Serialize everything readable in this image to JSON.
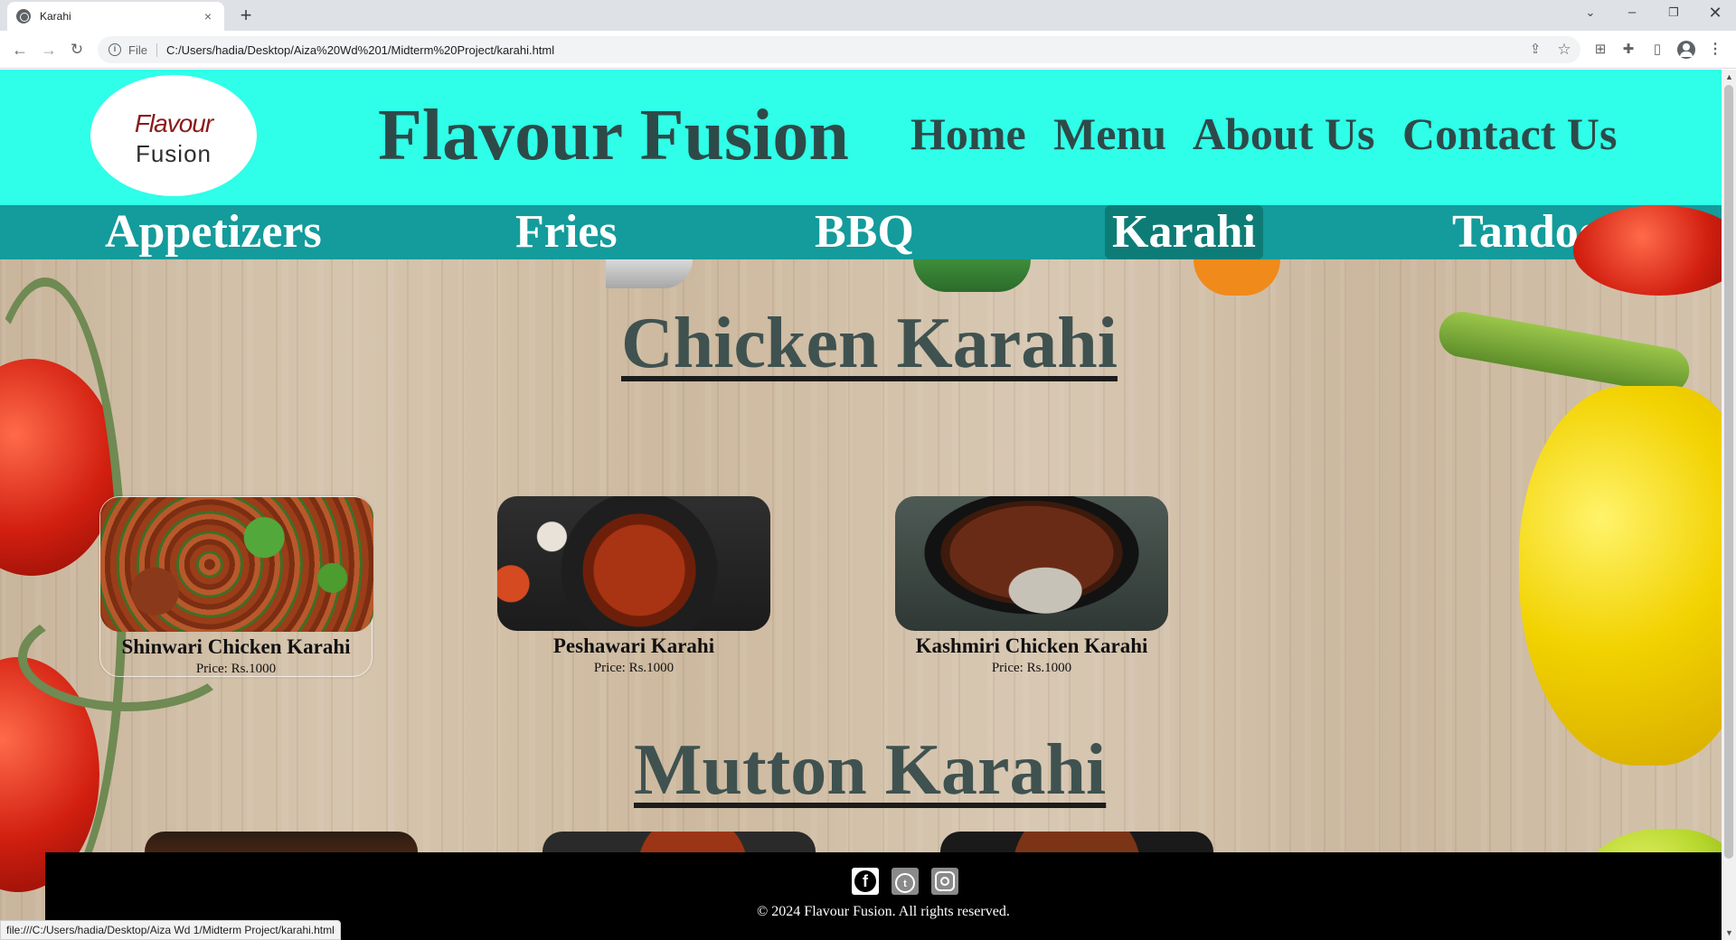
{
  "browser": {
    "tab_title": "Karahi",
    "tab_close": "×",
    "new_tab": "+",
    "url_chip": "File",
    "url": "C:/Users/hadia/Desktop/Aiza%20Wd%201/Midterm%20Project/karahi.html",
    "status_url": "file:///C:/Users/hadia/Desktop/Aiza Wd 1/Midterm Project/karahi.html",
    "icons": {
      "back": "←",
      "forward": "→",
      "reload": "↻",
      "info": "i",
      "share": "⇪",
      "star": "☆",
      "extension": "⊞",
      "puzzle": "✚",
      "side_panel": "▯",
      "menu": "⋮",
      "tab_search": "⌄",
      "minimize": "–",
      "maximize": "❐",
      "close": "✕"
    }
  },
  "site": {
    "logo_top": "Flavour",
    "logo_bottom": "Fusion",
    "title": "Flavour Fusion",
    "nav": [
      "Home",
      "Menu",
      "About Us",
      "Contact Us"
    ],
    "categories": [
      "Appetizers",
      "Fries",
      "BBQ",
      "Karahi",
      "Tandoor"
    ],
    "active_category": "Karahi",
    "colors": {
      "header_bg": "#2ffee8",
      "category_bar_bg": "#149b9b",
      "active_category_bg": "#0e7c76",
      "title_text": "#2e4a48",
      "footer_bg": "#000000"
    }
  },
  "sections": [
    {
      "title": "Chicken Karahi",
      "items": [
        {
          "name": "Shinwari Chicken Karahi",
          "price": "Price: Rs.1000"
        },
        {
          "name": "Peshawari Karahi",
          "price": "Price: Rs.1000"
        },
        {
          "name": "Kashmiri Chicken Karahi",
          "price": "Price: Rs.1000"
        }
      ]
    },
    {
      "title": "Mutton Karahi",
      "items": []
    }
  ],
  "footer": {
    "social_icons": [
      "facebook-icon",
      "twitter-icon",
      "instagram-icon"
    ],
    "facebook_glyph": "f",
    "twitter_glyph": "t",
    "copyright": "© 2024 Flavour Fusion. All rights reserved."
  }
}
